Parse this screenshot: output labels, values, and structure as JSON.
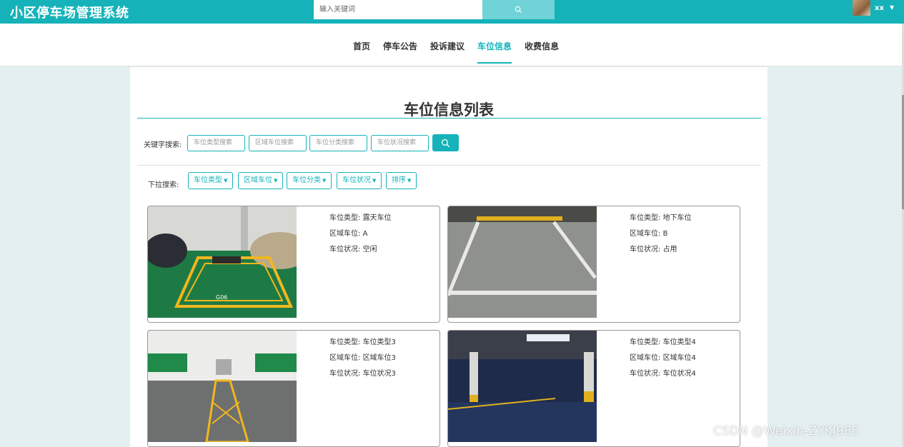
{
  "header": {
    "title": "小区停车场管理系统",
    "search_placeholder": "输入关键词",
    "user_name": "xx"
  },
  "nav": {
    "items": [
      {
        "label": "首页",
        "active": false
      },
      {
        "label": "停车公告",
        "active": false
      },
      {
        "label": "投诉建议",
        "active": false
      },
      {
        "label": "车位信息",
        "active": true
      },
      {
        "label": "收费信息",
        "active": false
      }
    ]
  },
  "page": {
    "title": "车位信息列表"
  },
  "keyword_search": {
    "label": "关键字搜索:",
    "inputs": [
      "车位类型搜索",
      "区域车位搜索",
      "车位分类搜索",
      "车位状况搜索"
    ]
  },
  "dropdown_search": {
    "label": "下拉搜索:",
    "buttons": [
      "车位类型",
      "区域车位",
      "车位分类",
      "车位状况",
      "排序"
    ]
  },
  "cards": [
    {
      "type_label": "车位类型: ",
      "type": "露天车位",
      "area_label": "区域车位: ",
      "area": "A",
      "status_label": "车位状况: ",
      "status": "空闲"
    },
    {
      "type_label": "车位类型: ",
      "type": "地下车位",
      "area_label": "区域车位: ",
      "area": "B",
      "status_label": "车位状况: ",
      "status": "占用"
    },
    {
      "type_label": "车位类型: ",
      "type": "车位类型3",
      "area_label": "区域车位: ",
      "area": "区域车位3",
      "status_label": "车位状况: ",
      "status": "车位状况3"
    },
    {
      "type_label": "车位类型: ",
      "type": "车位类型4",
      "area_label": "区域车位: ",
      "area": "区域车位4",
      "status_label": "车位状况: ",
      "status": "车位状况4"
    }
  ],
  "watermark": "CSDN @Weixin-ZYKJ985",
  "colors": {
    "accent": "#15b3b9",
    "accent_light": "#6fd3d7",
    "background": "#e4eff1"
  }
}
